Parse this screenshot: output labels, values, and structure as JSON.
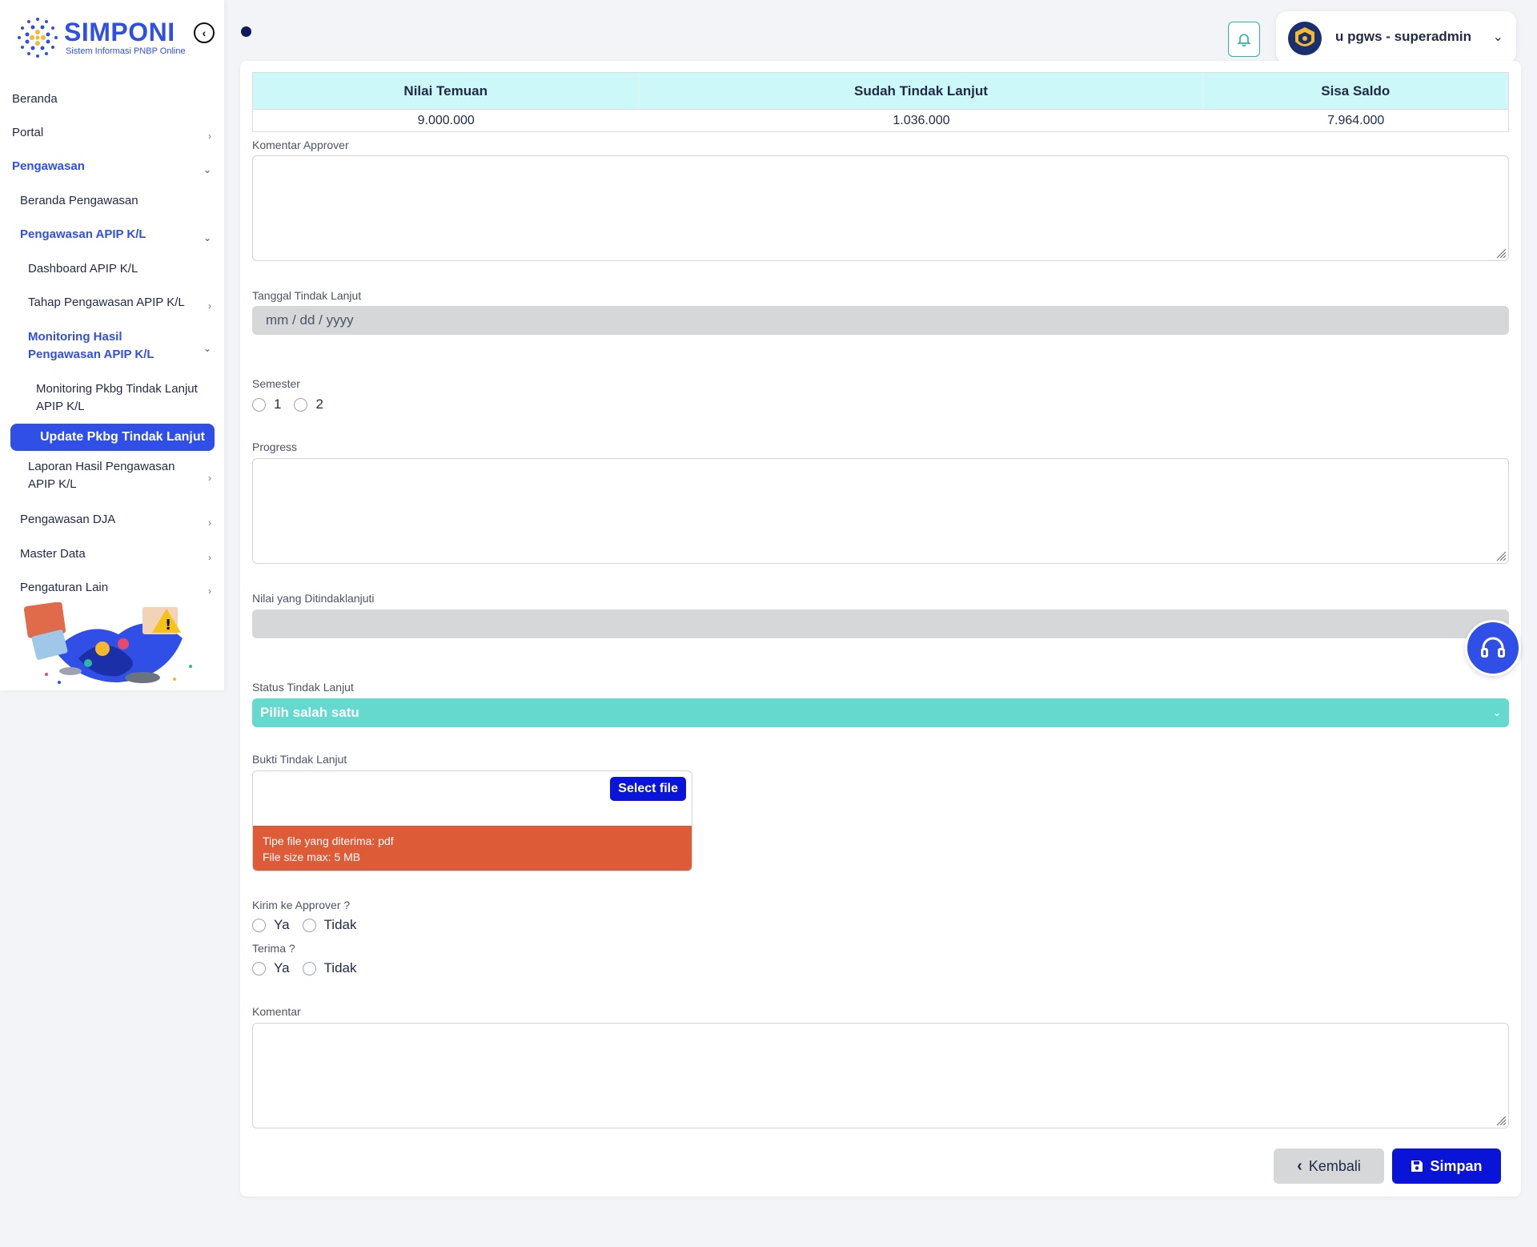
{
  "logo": {
    "title": "SIMPONI",
    "subtitle": "Sistem Informasi PNBP Online"
  },
  "sidebar": {
    "items": [
      {
        "label": "Beranda"
      },
      {
        "label": "Portal"
      },
      {
        "label": "Pengawasan"
      },
      {
        "label": "Beranda Pengawasan"
      },
      {
        "label": "Pengawasan APIP K/L"
      },
      {
        "label": "Dashboard APIP K/L"
      },
      {
        "label": "Tahap Pengawasan APIP K/L"
      },
      {
        "label": "Monitoring Hasil Pengawasan APIP K/L"
      },
      {
        "label": "Monitoring Pkbg Tindak Lanjut APIP K/L"
      },
      {
        "label": "Update Pkbg Tindak Lanjut"
      },
      {
        "label": "Laporan Hasil Pengawasan APIP K/L"
      },
      {
        "label": "Pengawasan DJA"
      },
      {
        "label": "Master Data"
      },
      {
        "label": "Pengaturan Lain"
      }
    ]
  },
  "header": {
    "user_name": "u pgws - superadmin"
  },
  "summary": {
    "headers": [
      "Nilai Temuan",
      "Sudah Tindak Lanjut",
      "Sisa Saldo"
    ],
    "values": [
      "9.000.000",
      "1.036.000",
      "7.964.000"
    ]
  },
  "form": {
    "komentar_approver_label": "Komentar Approver",
    "tanggal_label": "Tanggal Tindak Lanjut",
    "tanggal_placeholder": "mm / dd / yyyy",
    "semester_label": "Semester",
    "semester_options": [
      "1",
      "2"
    ],
    "progress_label": "Progress",
    "nilai_label": "Nilai yang Ditindaklanjuti",
    "status_label": "Status Tindak Lanjut",
    "status_value": "Pilih salah satu",
    "bukti_label": "Bukti Tindak Lanjut",
    "select_file": "Select file",
    "file_type": "Tipe file yang diterima: pdf",
    "file_size": "File size max: 5 MB",
    "kirim_label": "Kirim ke Approver ?",
    "terima_label": "Terima ?",
    "yes": "Ya",
    "no": "Tidak",
    "komentar_label": "Komentar"
  },
  "buttons": {
    "back": "Kembali",
    "save": "Simpan"
  },
  "colors": {
    "primary": "#2f4fe6",
    "teal": "#66d9cf",
    "save": "#0a14d9",
    "file_info": "#de5b38"
  }
}
